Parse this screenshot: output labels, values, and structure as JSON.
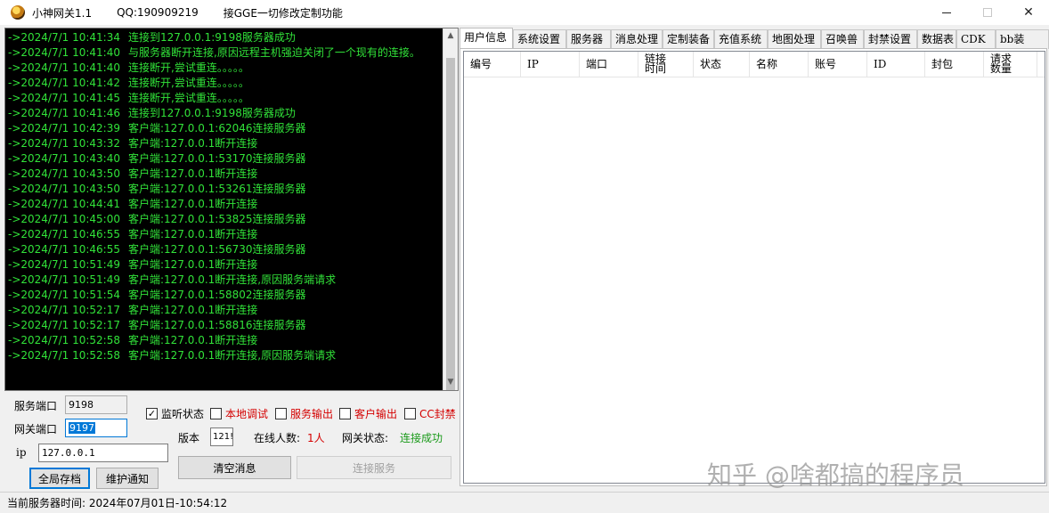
{
  "titlebar": {
    "app_name": "小神网关1.1",
    "qq": "QQ:190909219",
    "ad": "接GGE一切修改定制功能",
    "controls": {
      "minimize": "—",
      "maximize": "□",
      "close": "✕"
    }
  },
  "log": [
    {
      "time": "->2024/7/1 10:41:34",
      "msg": "连接到127.0.0.1:9198服务器成功"
    },
    {
      "time": "->2024/7/1 10:41:40",
      "msg": "与服务器断开连接,原因远程主机强迫关闭了一个现有的连接。"
    },
    {
      "time": "->2024/7/1 10:41:40",
      "msg": "连接断开,尝试重连。。。。。"
    },
    {
      "time": "->2024/7/1 10:41:42",
      "msg": "连接断开,尝试重连。。。。。"
    },
    {
      "time": "->2024/7/1 10:41:45",
      "msg": "连接断开,尝试重连。。。。。"
    },
    {
      "time": "->2024/7/1 10:41:46",
      "msg": "连接到127.0.0.1:9198服务器成功"
    },
    {
      "time": "->2024/7/1 10:42:39",
      "msg": "客户端:127.0.0.1:62046连接服务器"
    },
    {
      "time": "->2024/7/1 10:43:32",
      "msg": "客户端:127.0.0.1断开连接"
    },
    {
      "time": "->2024/7/1 10:43:40",
      "msg": "客户端:127.0.0.1:53170连接服务器"
    },
    {
      "time": "->2024/7/1 10:43:50",
      "msg": "客户端:127.0.0.1断开连接"
    },
    {
      "time": "->2024/7/1 10:43:50",
      "msg": "客户端:127.0.0.1:53261连接服务器"
    },
    {
      "time": "->2024/7/1 10:44:41",
      "msg": "客户端:127.0.0.1断开连接"
    },
    {
      "time": "->2024/7/1 10:45:00",
      "msg": "客户端:127.0.0.1:53825连接服务器"
    },
    {
      "time": "->2024/7/1 10:46:55",
      "msg": "客户端:127.0.0.1断开连接"
    },
    {
      "time": "->2024/7/1 10:46:55",
      "msg": "客户端:127.0.0.1:56730连接服务器"
    },
    {
      "time": "->2024/7/1 10:51:49",
      "msg": "客户端:127.0.0.1断开连接"
    },
    {
      "time": "->2024/7/1 10:51:49",
      "msg": "客户端:127.0.0.1断开连接,原因服务端请求"
    },
    {
      "time": "->2024/7/1 10:51:54",
      "msg": "客户端:127.0.0.1:58802连接服务器"
    },
    {
      "time": "->2024/7/1 10:52:17",
      "msg": "客户端:127.0.0.1断开连接"
    },
    {
      "time": "->2024/7/1 10:52:17",
      "msg": "客户端:127.0.0.1:58816连接服务器"
    },
    {
      "time": "->2024/7/1 10:52:58",
      "msg": "客户端:127.0.0.1断开连接"
    },
    {
      "time": "->2024/7/1 10:52:58",
      "msg": "客户端:127.0.0.1断开连接,原因服务端请求"
    }
  ],
  "controls": {
    "server_port_label": "服务端口",
    "server_port_value": "9198",
    "gateway_port_label": "网关端口",
    "gateway_port_value": "9197",
    "ip_label": "ip",
    "ip_value": "127.0.0.1",
    "save_all": "全局存档",
    "maintenance": "维护通知",
    "listen_state": "监听状态",
    "local_debug": "本地调试",
    "server_output": "服务输出",
    "client_output": "客户输出",
    "cc_block": "CC封禁",
    "version_label": "版本",
    "version_value": "121!",
    "online_label": "在线人数:",
    "online_value": "1人",
    "gateway_status_label": "网关状态:",
    "gateway_status_value": "连接成功",
    "clear_messages": "清空消息",
    "connect_server": "连接服务",
    "check_mark": "✓"
  },
  "statusbar": {
    "text": "当前服务器时间:  2024年07月01日-10:54:12"
  },
  "tabs": [
    "用户信息",
    "系统设置",
    "服务器",
    "消息处理",
    "定制装备",
    "充值系统",
    "地图处理",
    "召唤兽",
    "封禁设置",
    "数据表",
    "CDK",
    "bb装"
  ],
  "table": {
    "columns": [
      "编号",
      "IP",
      "端口",
      "链接时间",
      "状态",
      "名称",
      "账号",
      "ID",
      "封包",
      "请求数量"
    ]
  },
  "watermark": "知乎 @啥都搞的程序员",
  "colors": {
    "log_text": "#31e239",
    "log_bg": "#000000",
    "accent": "#0078d7",
    "warning": "#d40000",
    "ok": "#1a9a1a"
  }
}
